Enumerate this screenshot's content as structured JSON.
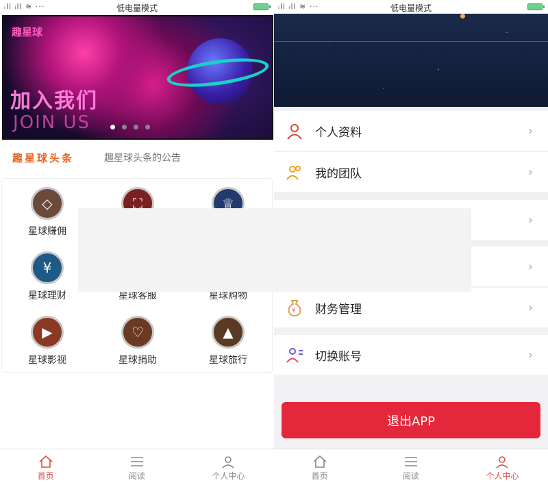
{
  "status_bar": {
    "signal": "ᵢll ᵢll ≋ ···",
    "mode": "低电量模式"
  },
  "banner": {
    "logo": "趣星球",
    "title_cn": "加入我们",
    "title_en": "JOIN US",
    "dots": 4,
    "active_dot": 0
  },
  "headline": {
    "brand": "趣星球头条",
    "notice": "趣星球头条的公告"
  },
  "grid": [
    {
      "label": "星球赚佣",
      "icon": "diamond-icon",
      "color": "#6b4a3a"
    },
    {
      "label": "",
      "icon": "scan-icon",
      "color": "#7a2020"
    },
    {
      "label": "",
      "icon": "crown-icon",
      "color": "#243a6e"
    },
    {
      "label": "星球理财",
      "icon": "ticket-icon",
      "color": "#1d5a86"
    },
    {
      "label": "星球客服",
      "icon": "service-icon",
      "color": "#555"
    },
    {
      "label": "星球购物",
      "icon": "cart-icon",
      "color": "#555"
    },
    {
      "label": "星球影视",
      "icon": "film-icon",
      "color": "#8a3a22"
    },
    {
      "label": "星球捐助",
      "icon": "heart-icon",
      "color": "#6a3a22"
    },
    {
      "label": "星球旅行",
      "icon": "rocket-icon",
      "color": "#5a3a22"
    }
  ],
  "tabs": [
    {
      "label": "首页",
      "icon": "home-icon"
    },
    {
      "label": "阅读",
      "icon": "list-icon"
    },
    {
      "label": "个人中心",
      "icon": "user-icon"
    }
  ],
  "left_active_tab": 0,
  "right_active_tab": 2,
  "menu": [
    {
      "label": "个人资料",
      "icon": "person-icon",
      "color": "#e0453a"
    },
    {
      "label": "我的团队",
      "icon": "team-icon",
      "color": "#f0a020"
    },
    {
      "label": "",
      "icon": "",
      "color": ""
    },
    {
      "label": "",
      "icon": "",
      "color": ""
    },
    {
      "label": "财务管理",
      "icon": "money-bag-icon",
      "color": "#e0a050"
    },
    {
      "label": "切换账号",
      "icon": "switch-account-icon",
      "color": "#6a5acd"
    }
  ],
  "logout_label": "退出APP",
  "chevron": "›"
}
